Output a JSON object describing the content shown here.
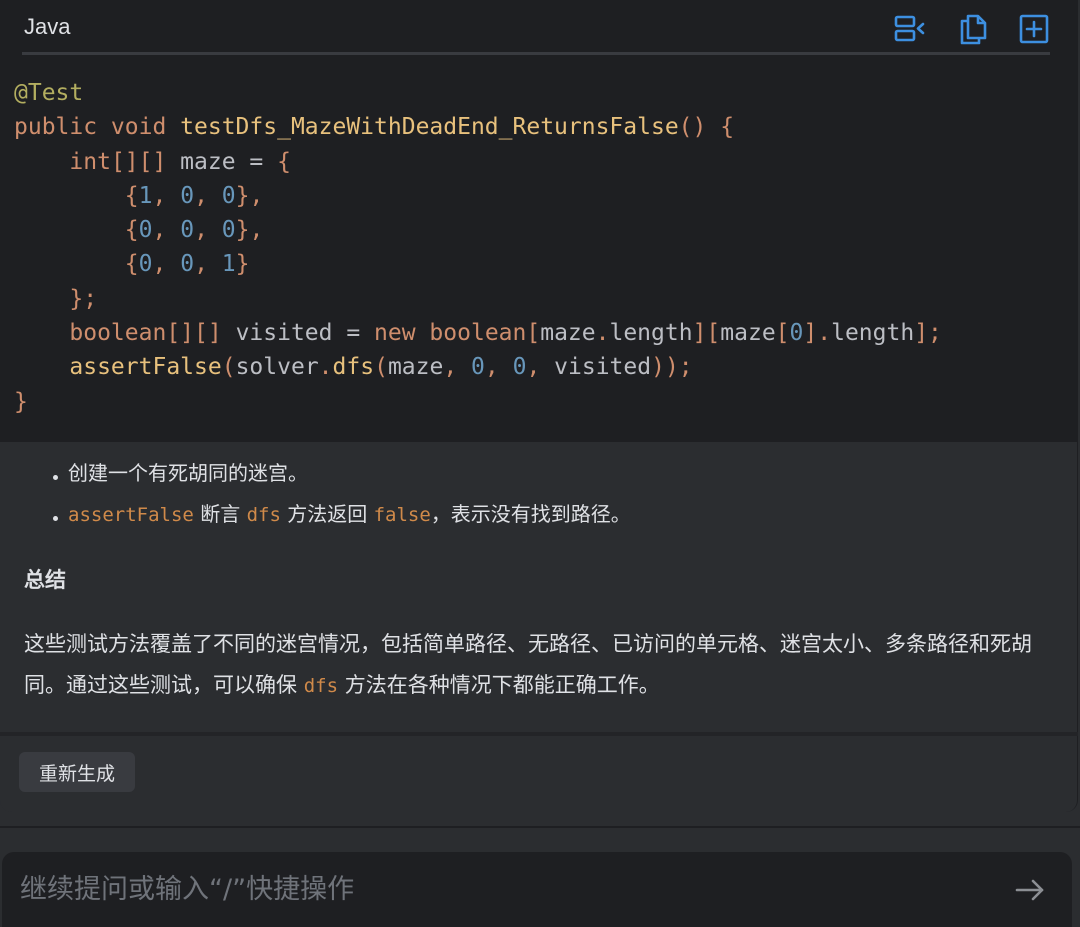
{
  "code_block": {
    "language": "Java",
    "icons": [
      "insert-at-cursor-icon",
      "copy-icon",
      "new-file-icon"
    ],
    "lines": [
      [
        [
          "ann",
          "@Test"
        ]
      ],
      [
        [
          "kw",
          "public void "
        ],
        [
          "fn",
          "testDfs_MazeWithDeadEnd_ReturnsFalse"
        ],
        [
          "pun",
          "() {"
        ]
      ],
      [
        [
          "id",
          "    "
        ],
        [
          "kw",
          "int"
        ],
        [
          "pun",
          "[][]"
        ],
        [
          "id",
          " maze = "
        ],
        [
          "pun",
          "{"
        ]
      ],
      [
        [
          "id",
          "        "
        ],
        [
          "pun",
          "{"
        ],
        [
          "num",
          "1"
        ],
        [
          "pun",
          ", "
        ],
        [
          "num",
          "0"
        ],
        [
          "pun",
          ", "
        ],
        [
          "num",
          "0"
        ],
        [
          "pun",
          "},"
        ]
      ],
      [
        [
          "id",
          "        "
        ],
        [
          "pun",
          "{"
        ],
        [
          "num",
          "0"
        ],
        [
          "pun",
          ", "
        ],
        [
          "num",
          "0"
        ],
        [
          "pun",
          ", "
        ],
        [
          "num",
          "0"
        ],
        [
          "pun",
          "},"
        ]
      ],
      [
        [
          "id",
          "        "
        ],
        [
          "pun",
          "{"
        ],
        [
          "num",
          "0"
        ],
        [
          "pun",
          ", "
        ],
        [
          "num",
          "0"
        ],
        [
          "pun",
          ", "
        ],
        [
          "num",
          "1"
        ],
        [
          "pun",
          "}"
        ]
      ],
      [
        [
          "id",
          "    "
        ],
        [
          "pun",
          "};"
        ]
      ],
      [
        [
          "id",
          "    "
        ],
        [
          "kw",
          "boolean"
        ],
        [
          "pun",
          "[][]"
        ],
        [
          "id",
          " visited = "
        ],
        [
          "kw",
          "new boolean"
        ],
        [
          "pun",
          "["
        ],
        [
          "id",
          "maze"
        ],
        [
          "pun",
          "."
        ],
        [
          "id",
          "length"
        ],
        [
          "pun",
          "]["
        ],
        [
          "id",
          "maze"
        ],
        [
          "pun",
          "["
        ],
        [
          "num",
          "0"
        ],
        [
          "pun",
          "]."
        ],
        [
          "id",
          "length"
        ],
        [
          "pun",
          "];"
        ]
      ],
      [
        [
          "id",
          "    "
        ],
        [
          "fn",
          "assertFalse"
        ],
        [
          "pun",
          "("
        ],
        [
          "id",
          "solver"
        ],
        [
          "pun",
          "."
        ],
        [
          "fn",
          "dfs"
        ],
        [
          "pun",
          "("
        ],
        [
          "id",
          "maze"
        ],
        [
          "pun",
          ", "
        ],
        [
          "num",
          "0"
        ],
        [
          "pun",
          ", "
        ],
        [
          "num",
          "0"
        ],
        [
          "pun",
          ", "
        ],
        [
          "id",
          "visited"
        ],
        [
          "pun",
          "));"
        ]
      ],
      [
        [
          "pun",
          "}"
        ]
      ]
    ]
  },
  "bullets": [
    [
      [
        "text",
        "创建一个有死胡同的迷宫。"
      ]
    ],
    [
      [
        "code",
        "assertFalse"
      ],
      [
        "text",
        " 断言 "
      ],
      [
        "code",
        "dfs"
      ],
      [
        "text",
        " 方法返回 "
      ],
      [
        "code",
        "false"
      ],
      [
        "text",
        "，表示没有找到路径。"
      ]
    ]
  ],
  "summary": {
    "title": "总结",
    "paragraph": [
      [
        "text",
        "这些测试方法覆盖了不同的迷宫情况，包括简单路径、无路径、已访问的单元格、迷宫太小、多条路径和死胡同。通过这些测试，可以确保 "
      ],
      [
        "code",
        "dfs"
      ],
      [
        "text",
        " 方法在各种情况下都能正确工作。"
      ]
    ]
  },
  "actions": {
    "regenerate_label": "重新生成"
  },
  "input": {
    "placeholder": "继续提问或输入“/”快捷操作",
    "value": ""
  },
  "colors": {
    "keyword": "#cf8e6d",
    "function": "#e8c17d",
    "number": "#6897bb",
    "annotation": "#b3ae60",
    "accent": "#3d8fe0"
  }
}
